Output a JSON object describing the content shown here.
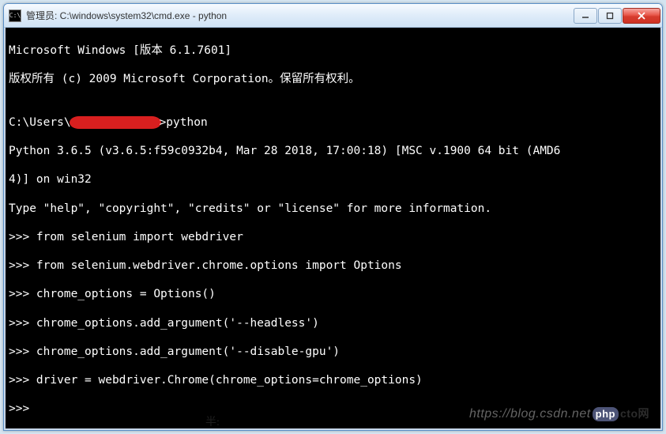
{
  "window": {
    "title": "管理员: C:\\windows\\system32\\cmd.exe - python",
    "icon_label": "C:\\"
  },
  "terminal": {
    "line1": "Microsoft Windows [版本 6.1.7601]",
    "line2": "版权所有 (c) 2009 Microsoft Corporation。保留所有权利。",
    "blank": "",
    "prompt_prefix": "C:\\Users\\",
    "prompt_suffix": ">python",
    "py_banner1": "Python 3.6.5 (v3.6.5:f59c0932b4, Mar 28 2018, 17:00:18) [MSC v.1900 64 bit (AMD6",
    "py_banner2": "4)] on win32",
    "py_help": "Type \"help\", \"copyright\", \"credits\" or \"license\" for more information.",
    "p1": ">>> ",
    "cmd1": "from selenium import webdriver",
    "cmd2": "from selenium.webdriver.chrome.options import Options",
    "cmd3": "chrome_options = Options()",
    "cmd4": "chrome_options.add_argument('--headless')",
    "cmd5": "chrome_options.add_argument('--disable-gpu')",
    "cmd6": "driver = webdriver.Chrome(chrome_options=chrome_options)"
  },
  "watermark": {
    "url": "https://blog.csdn.net",
    "php": "php",
    "cto": "cto网"
  },
  "caption": "半:"
}
